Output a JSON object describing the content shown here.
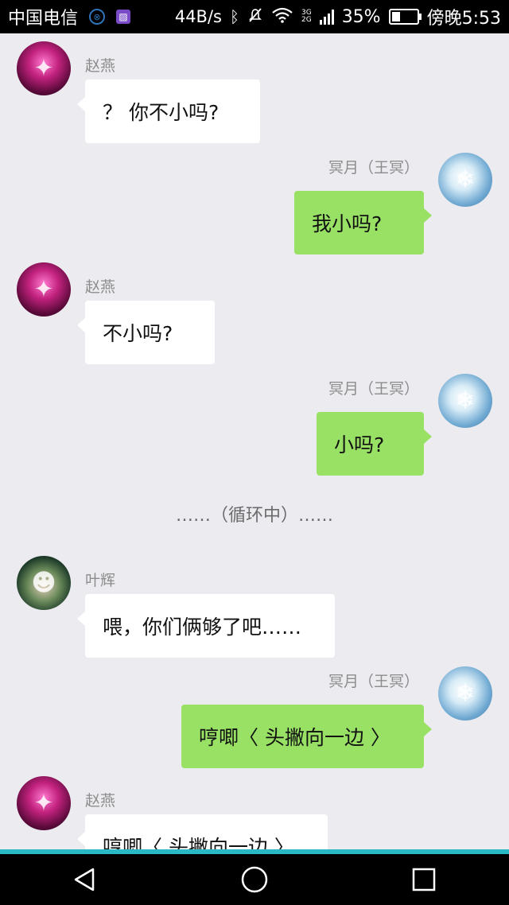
{
  "status_bar": {
    "carrier": "中国电信",
    "speed": "44B/s",
    "network_top": "3G",
    "network_bottom": "2G",
    "battery_percent": "35%",
    "battery_level": 0.35,
    "time": "傍晚5:53"
  },
  "messages": [
    {
      "side": "left",
      "sender": "赵燕",
      "text": "？ 你不小吗?",
      "avatar": "zhao"
    },
    {
      "side": "right",
      "sender": "冥月（王冥）",
      "text": "我小吗?",
      "avatar": "ming"
    },
    {
      "side": "left",
      "sender": "赵燕",
      "text": "不小吗?",
      "avatar": "zhao"
    },
    {
      "side": "right",
      "sender": "冥月（王冥）",
      "text": "小吗?",
      "avatar": "ming"
    },
    {
      "side": "left",
      "sender": "叶辉",
      "text": "喂，你们俩够了吧……",
      "avatar": "ye"
    },
    {
      "side": "right",
      "sender": "冥月（王冥）",
      "text": "哼唧〈 头撇向一边 〉",
      "avatar": "ming"
    },
    {
      "side": "left",
      "sender": "赵燕",
      "text": "哼唧〈 头撇向一边 〉",
      "avatar": "zhao"
    }
  ],
  "system_note": "……（循环中）……",
  "nav": {
    "back": "back-icon",
    "home": "home-icon",
    "recents": "recents-icon"
  },
  "colors": {
    "background": "#ececf0",
    "self_bubble": "#98e165",
    "other_bubble": "#ffffff",
    "nav_accent": "#29b8c4"
  }
}
